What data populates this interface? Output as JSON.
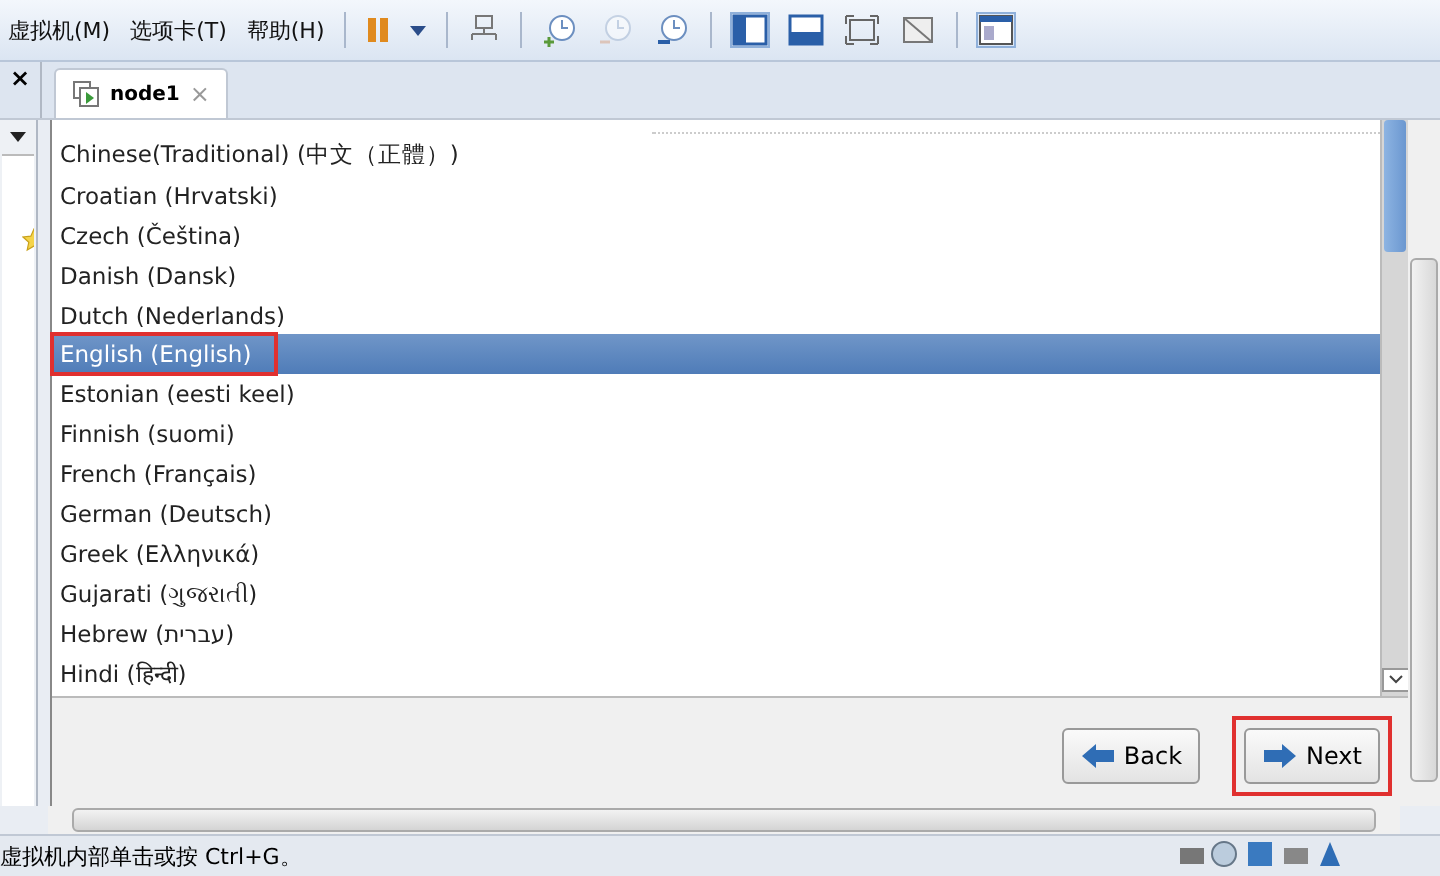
{
  "menu": [
    "虚拟机(M)",
    "选项卡(T)",
    "帮助(H)"
  ],
  "tab": {
    "label": "node1",
    "close": "×"
  },
  "sidebar": {
    "close": "×"
  },
  "languages": [
    {
      "label": "Chinese(Traditional) (中文（正體）)",
      "selected": false,
      "annotated": false
    },
    {
      "label": "Croatian (Hrvatski)",
      "selected": false,
      "annotated": false
    },
    {
      "label": "Czech (Čeština)",
      "selected": false,
      "annotated": false
    },
    {
      "label": "Danish (Dansk)",
      "selected": false,
      "annotated": false
    },
    {
      "label": "Dutch (Nederlands)",
      "selected": false,
      "annotated": false
    },
    {
      "label": "English (English)",
      "selected": true,
      "annotated": true
    },
    {
      "label": "Estonian (eesti keel)",
      "selected": false,
      "annotated": false
    },
    {
      "label": "Finnish (suomi)",
      "selected": false,
      "annotated": false
    },
    {
      "label": "French (Français)",
      "selected": false,
      "annotated": false
    },
    {
      "label": "German (Deutsch)",
      "selected": false,
      "annotated": false
    },
    {
      "label": "Greek (Ελληνικά)",
      "selected": false,
      "annotated": false
    },
    {
      "label": "Gujarati (ગુજરાતી)",
      "selected": false,
      "annotated": false
    },
    {
      "label": "Hebrew (עברית)",
      "selected": false,
      "annotated": false
    },
    {
      "label": "Hindi (हिन्दी)",
      "selected": false,
      "annotated": false
    }
  ],
  "buttons": [
    {
      "label": "Back",
      "kind": "back"
    },
    {
      "label": "Next",
      "kind": "next",
      "annotated": true
    }
  ],
  "status_bar": {
    "text": "虚拟机内部单击或按 Ctrl+G。"
  }
}
